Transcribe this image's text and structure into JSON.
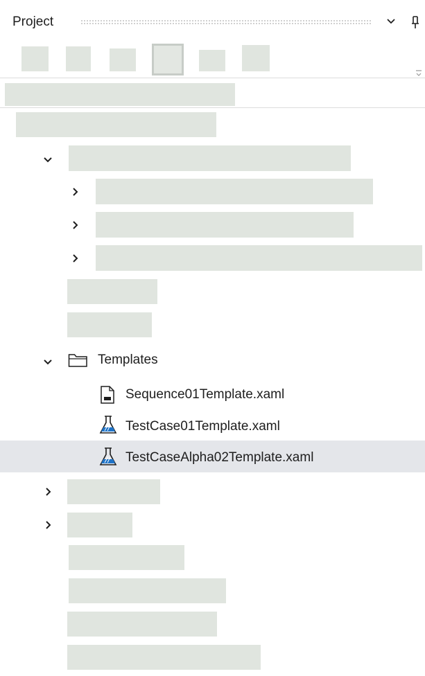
{
  "panel": {
    "title": "Project"
  },
  "tree": {
    "templates_folder": {
      "label": "Templates",
      "icon": "folder-icon"
    },
    "files": [
      {
        "label": "Sequence01Template.xaml",
        "icon": "sequence-file-icon"
      },
      {
        "label": "TestCase01Template.xaml",
        "icon": "test-flask-icon"
      },
      {
        "label": "TestCaseAlpha02Template.xaml",
        "icon": "test-flask-icon",
        "selected": true
      }
    ]
  },
  "colors": {
    "placeholder": "#e0e5df",
    "selection": "#e4e6ea",
    "flask_blue": "#1e73c8",
    "text": "#1e1e1e"
  }
}
